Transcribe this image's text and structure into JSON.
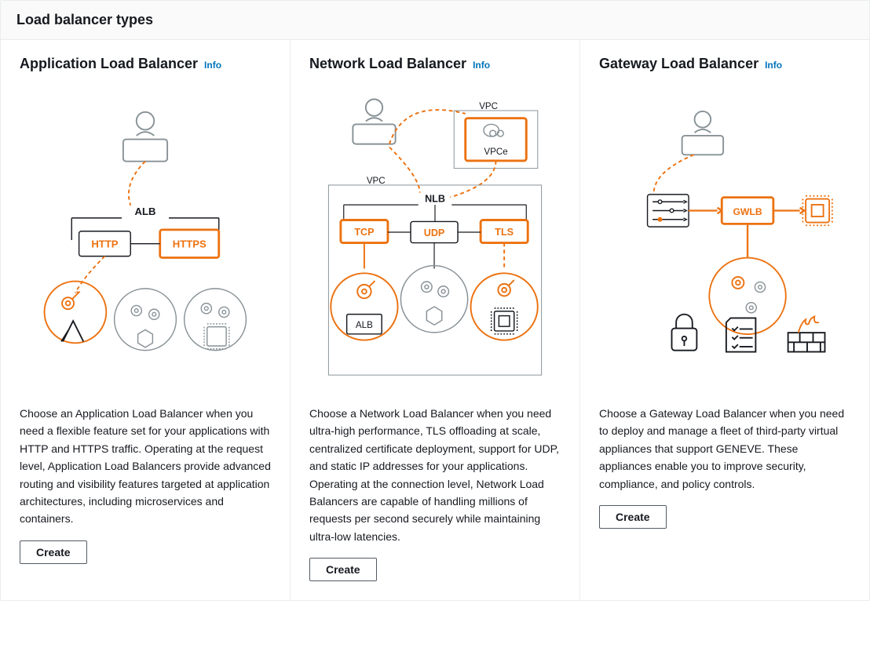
{
  "page_title": "Load balancer types",
  "info_label": "Info",
  "create_label": "Create",
  "cards": {
    "alb": {
      "title": "Application Load Balancer",
      "desc": "Choose an Application Load Balancer when you need a flexible feature set for your applications with HTTP and HTTPS traffic. Operating at the request level, Application Load Balancers provide advanced routing and visibility features targeted at application architectures, including microservices and containers.",
      "diagram": {
        "label": "ALB",
        "protocols": [
          "HTTP",
          "HTTPS"
        ]
      }
    },
    "nlb": {
      "title": "Network Load Balancer",
      "desc": "Choose a Network Load Balancer when you need ultra-high performance, TLS offloading at scale, centralized certificate deployment, support for UDP, and static IP addresses for your applications. Operating at the connection level, Network Load Balancers are capable of handling millions of requests per second securely while maintaining ultra-low latencies.",
      "diagram": {
        "label": "NLB",
        "vpc": "VPC",
        "vpce": "VPCe",
        "protocols": [
          "TCP",
          "UDP",
          "TLS"
        ],
        "alb_box": "ALB"
      }
    },
    "gwlb": {
      "title": "Gateway Load Balancer",
      "desc": "Choose a Gateway Load Balancer when you need to deploy and manage a fleet of third-party virtual appliances that support GENEVE. These appliances enable you to improve security, compliance, and policy controls.",
      "diagram": {
        "label": "GWLB"
      }
    }
  }
}
